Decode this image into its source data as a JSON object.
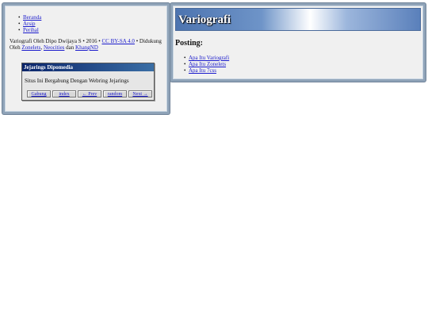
{
  "nav": {
    "items": [
      {
        "label": "Beranda"
      },
      {
        "label": "Arsip"
      },
      {
        "label": "Perihal"
      }
    ]
  },
  "footer": {
    "prefix": "Variografi Oleh Dipo Dwijaya S • 2016 • ",
    "license": "CC BY-SA 4.0",
    "middle": " • Didukung Oleh ",
    "host1": "Zonelets",
    "sep1": ", ",
    "host2": "Neocities",
    "sep2": " dan ",
    "host3": "KhangND"
  },
  "webring": {
    "title": "Jejarings Dipomedia",
    "description": "Situs Ini Bergabung Dengan Webring Jejarings",
    "links": [
      "Gabung",
      "index",
      "← Prev",
      "random",
      "Next →"
    ]
  },
  "main": {
    "title": "Variografi",
    "section_heading": "Posting:",
    "posts": [
      {
        "label": "Apa Itu Variografi"
      },
      {
        "label": "Apa Itu Zonelets"
      },
      {
        "label": "Apa Itu 7css"
      }
    ]
  }
}
